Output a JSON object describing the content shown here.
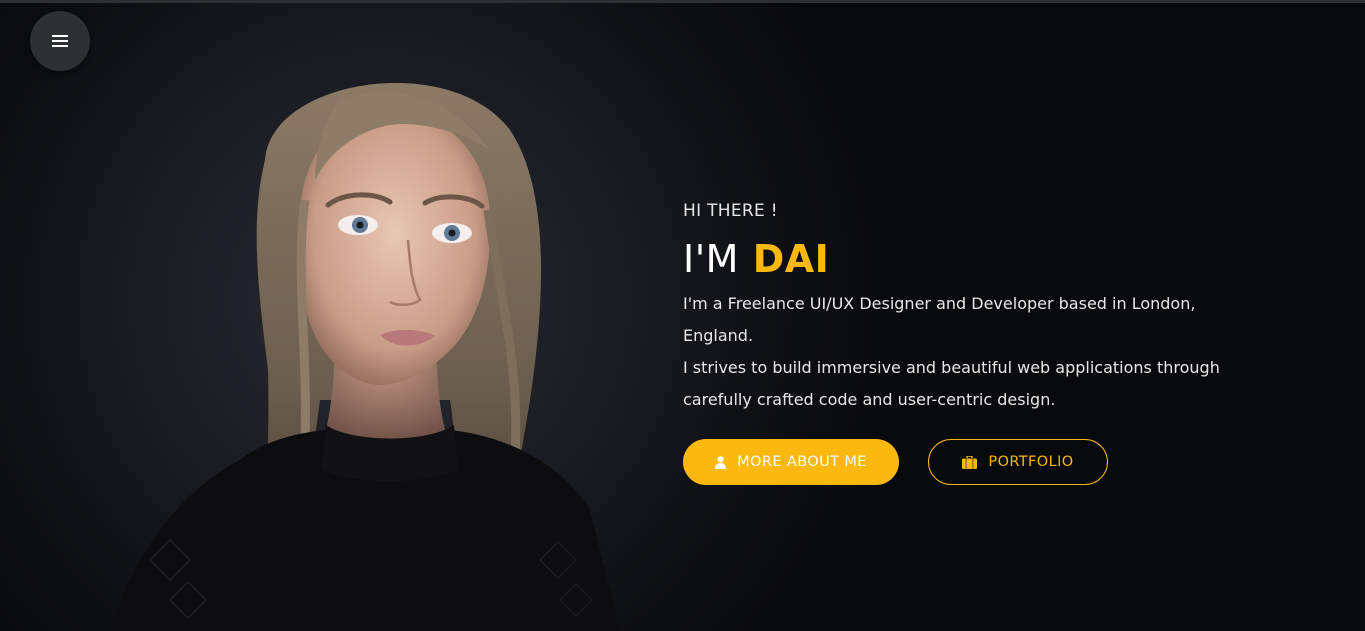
{
  "nav": {
    "menu_icon": "hamburger-icon"
  },
  "hero": {
    "greeting": "HI THERE !",
    "headline_prefix": "I'M",
    "headline_name": "DAI",
    "bio_lines": [
      "I'm a Freelance UI/UX Designer and Developer based in London, England.",
      "I strives to build immersive and beautiful web applications through",
      "carefully crafted code and user-centric design."
    ]
  },
  "buttons": {
    "about": {
      "label": "MORE ABOUT ME",
      "icon": "user-icon"
    },
    "portfolio": {
      "label": "PORTFOLIO",
      "icon": "briefcase-icon"
    }
  },
  "colors": {
    "accent": "#fbb80f",
    "background": "#0b0c10",
    "text": "#ffffff"
  }
}
